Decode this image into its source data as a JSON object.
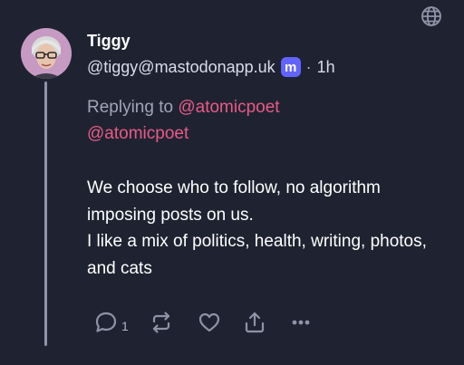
{
  "post": {
    "author_name": "Tiggy",
    "handle": "@tiggy@mastodonapp.uk",
    "badge_glyph": "m",
    "separator": "·",
    "time": "1h",
    "reply_prefix": "Replying to ",
    "reply_to": "@atomicpoet",
    "mention": "@atomicpoet",
    "body_lines": [
      "We choose who to follow, no algorithm imposing posts on us.",
      "I like a mix of politics, health, writing, photos, and cats"
    ],
    "reply_count": "1"
  },
  "icons": {
    "globe": "globe-icon",
    "reply": "reply-icon",
    "boost": "repost-icon",
    "like": "heart-icon",
    "share": "share-icon",
    "more": "more-icon"
  },
  "colors": {
    "background": "#1f2331",
    "mention": "#e95a87",
    "muted": "#9fa4b8",
    "icon": "#8e93a8",
    "badge": "#6364ff"
  }
}
